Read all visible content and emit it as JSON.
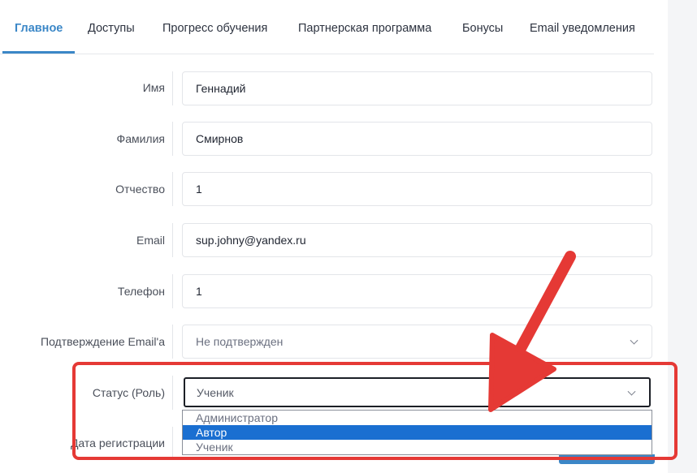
{
  "tabs": [
    {
      "label": "Главное",
      "active": true
    },
    {
      "label": "Доступы"
    },
    {
      "label": "Прогресс обучения"
    },
    {
      "label": "Партнерская программа"
    },
    {
      "label": "Бонусы"
    },
    {
      "label": "Email уведомления"
    }
  ],
  "form": {
    "first_name": {
      "label": "Имя",
      "value": "Геннадий"
    },
    "last_name": {
      "label": "Фамилия",
      "value": "Смирнов"
    },
    "middle_name": {
      "label": "Отчество",
      "value": "1"
    },
    "email": {
      "label": "Email",
      "value": "sup.johny@yandex.ru"
    },
    "phone": {
      "label": "Телефон",
      "value": "1"
    },
    "email_confirm": {
      "label": "Подтверждение Email'a",
      "value": "Не подтвержден"
    },
    "status": {
      "label": "Статус (Роль)",
      "value": "Ученик",
      "options": [
        "Администратор",
        "Автор",
        "Ученик"
      ],
      "highlighted_option": "Автор"
    },
    "registration_date": {
      "label": "Дата регистрации"
    }
  },
  "colors": {
    "accent": "#3b87c7",
    "annotation_red": "#e53935",
    "option_highlight": "#1a6fd1"
  },
  "annotations": [
    "red-arrow-icon",
    "red-highlight-box"
  ]
}
